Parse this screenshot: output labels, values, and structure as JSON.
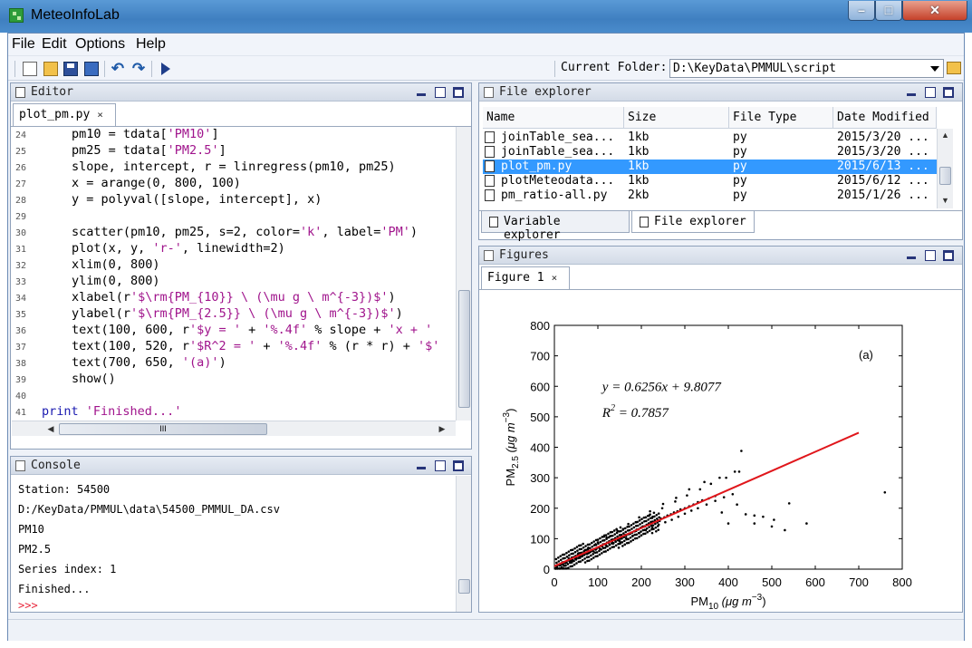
{
  "window": {
    "title": "MeteoInfoLab",
    "min_glyph": "–",
    "max_glyph": "□",
    "close_glyph": "✕"
  },
  "menu": [
    "File",
    "Edit",
    "Options",
    "Help"
  ],
  "toolbar": {
    "undo_glyph": "↶",
    "redo_glyph": "↷",
    "current_folder_label": "Current Folder:",
    "current_folder_value": "D:\\KeyData\\PMMUL\\script"
  },
  "editor": {
    "title": "Editor",
    "tab": "plot_pm.py",
    "tab_close": "×",
    "lines": [
      {
        "n": "24",
        "indent": true,
        "parts": [
          {
            "t": "pm10 = tdata["
          },
          {
            "t": "'PM10'",
            "c": "str"
          },
          {
            "t": "]"
          }
        ]
      },
      {
        "n": "25",
        "indent": true,
        "parts": [
          {
            "t": "pm25 = tdata["
          },
          {
            "t": "'PM2.5'",
            "c": "str"
          },
          {
            "t": "]"
          }
        ]
      },
      {
        "n": "26",
        "indent": true,
        "parts": [
          {
            "t": "slope, intercept, r = linregress(pm10, pm25)"
          }
        ]
      },
      {
        "n": "27",
        "indent": true,
        "parts": [
          {
            "t": "x = arange(0, 800, 100)"
          }
        ]
      },
      {
        "n": "28",
        "indent": true,
        "parts": [
          {
            "t": "y = polyval([slope, intercept], x)"
          }
        ]
      },
      {
        "n": "29",
        "indent": false,
        "parts": []
      },
      {
        "n": "30",
        "indent": true,
        "parts": [
          {
            "t": "scatter(pm10, pm25, s=2, color="
          },
          {
            "t": "'k'",
            "c": "str"
          },
          {
            "t": ", label="
          },
          {
            "t": "'PM'",
            "c": "str"
          },
          {
            "t": ")"
          }
        ]
      },
      {
        "n": "31",
        "indent": true,
        "parts": [
          {
            "t": "plot(x, y, "
          },
          {
            "t": "'r-'",
            "c": "str"
          },
          {
            "t": ", linewidth=2)"
          }
        ]
      },
      {
        "n": "32",
        "indent": true,
        "parts": [
          {
            "t": "xlim(0, 800)"
          }
        ]
      },
      {
        "n": "33",
        "indent": true,
        "parts": [
          {
            "t": "ylim(0, 800)"
          }
        ]
      },
      {
        "n": "34",
        "indent": true,
        "parts": [
          {
            "t": "xlabel(r"
          },
          {
            "t": "'$\\rm{PM_{10}} \\ (\\mu g \\ m^{-3})$'",
            "c": "str"
          },
          {
            "t": ")"
          }
        ]
      },
      {
        "n": "35",
        "indent": true,
        "parts": [
          {
            "t": "ylabel(r"
          },
          {
            "t": "'$\\rm{PM_{2.5}} \\ (\\mu g \\ m^{-3})$'",
            "c": "str"
          },
          {
            "t": ")"
          }
        ]
      },
      {
        "n": "36",
        "indent": true,
        "parts": [
          {
            "t": "text(100, 600, r"
          },
          {
            "t": "'$y = '",
            "c": "str"
          },
          {
            "t": " + "
          },
          {
            "t": "'%.4f'",
            "c": "str"
          },
          {
            "t": " % slope + "
          },
          {
            "t": "'x + '",
            "c": "str"
          }
        ]
      },
      {
        "n": "37",
        "indent": true,
        "parts": [
          {
            "t": "text(100, 520, r"
          },
          {
            "t": "'$R^2 = '",
            "c": "str"
          },
          {
            "t": " + "
          },
          {
            "t": "'%.4f'",
            "c": "str"
          },
          {
            "t": " % (r * r) + "
          },
          {
            "t": "'$'",
            "c": "str"
          }
        ]
      },
      {
        "n": "38",
        "indent": true,
        "parts": [
          {
            "t": "text(700, 650, "
          },
          {
            "t": "'(a)'",
            "c": "str"
          },
          {
            "t": ")"
          }
        ]
      },
      {
        "n": "39",
        "indent": true,
        "parts": [
          {
            "t": "show()"
          }
        ]
      },
      {
        "n": "40",
        "indent": false,
        "parts": []
      },
      {
        "n": "41",
        "indent": false,
        "parts": [
          {
            "t": "print",
            "c": "kw"
          },
          {
            "t": " "
          },
          {
            "t": "'Finished...'",
            "c": "str"
          }
        ]
      }
    ],
    "hscroll_grip": "III"
  },
  "console": {
    "title": "Console",
    "lines": [
      "Station: 54500",
      "D:/KeyData/PMMUL\\data\\54500_PMMUL_DA.csv",
      "PM10",
      "PM2.5",
      "Series index: 1",
      "Finished..."
    ],
    "prompt": ">>>"
  },
  "file_explorer": {
    "title": "File explorer",
    "columns": [
      "Name",
      "Size",
      "File Type",
      "Date Modified"
    ],
    "rows": [
      {
        "name": "joinTable_sea...",
        "size": "1kb",
        "type": "py",
        "date": "2015/3/20 ...",
        "selected": false
      },
      {
        "name": "joinTable_sea...",
        "size": "1kb",
        "type": "py",
        "date": "2015/3/20 ...",
        "selected": false
      },
      {
        "name": "plot_pm.py",
        "size": "1kb",
        "type": "py",
        "date": "2015/6/13 ...",
        "selected": true
      },
      {
        "name": "plotMeteodata...",
        "size": "1kb",
        "type": "py",
        "date": "2015/6/12 ...",
        "selected": false
      },
      {
        "name": "pm_ratio-all.py",
        "size": "2kb",
        "type": "py",
        "date": "2015/1/26 ...",
        "selected": false
      }
    ],
    "tabs": [
      "Variable explorer",
      "File explorer"
    ]
  },
  "figures": {
    "title": "Figures",
    "tab": "Figure 1",
    "tab_close": "×"
  },
  "chart_data": {
    "type": "scatter",
    "title": "",
    "xlabel": "PM10 (μg m⁻³)",
    "xlabel_main": "PM",
    "xlabel_sub": "10",
    "xlabel_unit": "(μg m",
    "ylabel": "PM2.5 (μg m⁻³)",
    "ylabel_main": "PM",
    "ylabel_sub": "2.5",
    "ylabel_unit": "(μg m",
    "unit_exp": "−3",
    "unit_close": ")",
    "xlim": [
      0,
      800
    ],
    "ylim": [
      0,
      800
    ],
    "xticks": [
      "0",
      "100",
      "200",
      "300",
      "400",
      "500",
      "600",
      "700",
      "800"
    ],
    "yticks": [
      "0",
      "100",
      "200",
      "300",
      "400",
      "500",
      "600",
      "700",
      "800"
    ],
    "annotations": {
      "equation": "y = 0.6256x + 9.8077",
      "r2_lhs": "R",
      "r2_exp": "2",
      "r2_rhs": " = 0.7857",
      "panel_label": "(a)"
    },
    "fit_line": {
      "color": "#e0161b",
      "x": [
        0,
        100,
        200,
        300,
        400,
        500,
        600,
        700
      ],
      "y": [
        9.81,
        72.37,
        134.93,
        197.49,
        260.05,
        322.61,
        385.17,
        447.73
      ]
    },
    "scatter_color": "#000000",
    "series": [
      {
        "name": "PM",
        "x": [
          5,
          12,
          20,
          28,
          35,
          42,
          50,
          58,
          65,
          72,
          80,
          88,
          95,
          103,
          110,
          118,
          125,
          133,
          140,
          148,
          155,
          163,
          170,
          178,
          185,
          193,
          200,
          208,
          215,
          222,
          230,
          238,
          245,
          253,
          260,
          268,
          275,
          283,
          290,
          300,
          310,
          320,
          330,
          340,
          355,
          370,
          385,
          400,
          420,
          440,
          460,
          480,
          500,
          540,
          580,
          760,
          15,
          25,
          38,
          48,
          60,
          75,
          90,
          105,
          120,
          135,
          150,
          165,
          180,
          195,
          210,
          225,
          240,
          255,
          270,
          285,
          300,
          315,
          330,
          350,
          370,
          390,
          410,
          430,
          45,
          70,
          95,
          120,
          145,
          170,
          195,
          220,
          250,
          280,
          310,
          345,
          380,
          415,
          18,
          33,
          55,
          78,
          100,
          128,
          158,
          188,
          218,
          248,
          278,
          305,
          335,
          360,
          395,
          425,
          460,
          505,
          530
        ],
        "y": [
          8,
          12,
          16,
          22,
          26,
          30,
          36,
          40,
          46,
          52,
          54,
          60,
          64,
          70,
          74,
          80,
          86,
          90,
          94,
          100,
          104,
          112,
          116,
          120,
          124,
          130,
          136,
          140,
          146,
          150,
          154,
          160,
          166,
          170,
          176,
          180,
          186,
          190,
          196,
          200,
          206,
          212,
          220,
          226,
          232,
          240,
          186,
          150,
          212,
          180,
          150,
          172,
          140,
          216,
          150,
          252,
          14,
          20,
          28,
          34,
          42,
          50,
          58,
          66,
          76,
          84,
          92,
          102,
          110,
          118,
          128,
          136,
          146,
          154,
          162,
          172,
          182,
          192,
          200,
          212,
          224,
          236,
          246,
          388,
          40,
          62,
          82,
          104,
          126,
          148,
          170,
          190,
          214,
          234,
          262,
          286,
          300,
          320,
          22,
          36,
          52,
          70,
          88,
          108,
          132,
          154,
          176,
          200,
          222,
          242,
          262,
          280,
          300,
          320,
          176,
          162,
          128
        ]
      }
    ]
  }
}
